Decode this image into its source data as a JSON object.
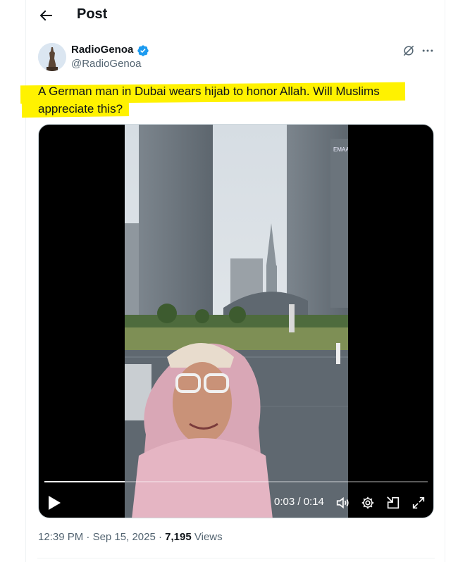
{
  "header": {
    "title": "Post"
  },
  "author": {
    "name": "RadioGenoa",
    "handle": "@RadioGenoa"
  },
  "tweet": {
    "line1": "A German man in Dubai wears hijab to honor Allah. Will Muslims",
    "line2": "appreciate this?"
  },
  "video": {
    "current_time": "0:03",
    "duration": "0:14",
    "time_label": "0:03 / 0:14",
    "progress": 0.21,
    "building_sign": "EMAA"
  },
  "meta": {
    "time": "12:39 PM",
    "date": "Sep 15, 2025",
    "views_count": "7,195",
    "views_label": "Views"
  },
  "colors": {
    "highlight": "#fff200",
    "verified": "#1d9bf0",
    "text_secondary": "#536471"
  }
}
